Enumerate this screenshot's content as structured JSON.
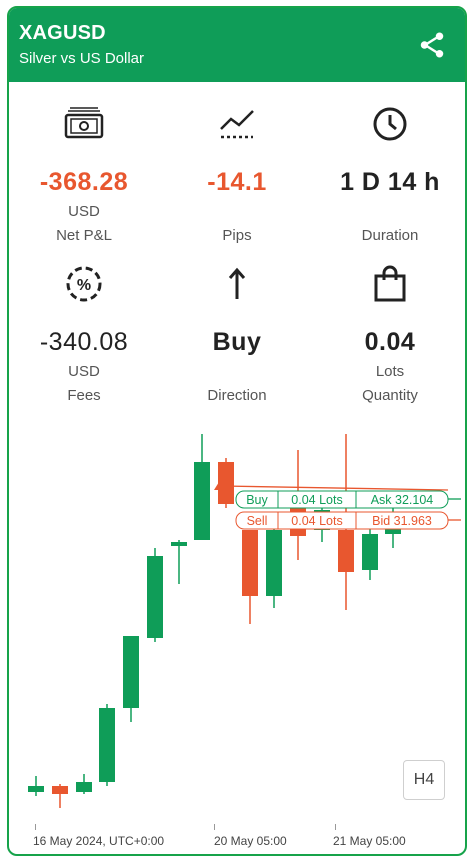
{
  "header": {
    "symbol": "XAGUSD",
    "description": "Silver vs US Dollar",
    "share_icon": "share-icon"
  },
  "stats": [
    {
      "icon": "cash-icon",
      "value": "-368.28",
      "unit": "USD",
      "label": "Net P&L",
      "color": "#e8572f"
    },
    {
      "icon": "trend-line-icon",
      "value": "-14.1",
      "unit": "",
      "label": "Pips",
      "color": "#e8572f"
    },
    {
      "icon": "clock-icon",
      "value": "1 D 14 h",
      "unit": "",
      "label": "Duration"
    },
    {
      "icon": "percent-dashed-icon",
      "value": "-340.08",
      "unit": "USD",
      "label": "Fees"
    },
    {
      "icon": "arrow-up-icon",
      "value": "Buy",
      "unit": "",
      "label": "Direction"
    },
    {
      "icon": "shopping-bag-icon",
      "value": "0.04",
      "unit": "Lots",
      "label": "Quantity"
    }
  ],
  "chart": {
    "timeframe": "H4",
    "time_labels": [
      "16 May 2024, UTC+0:00",
      "20 May 05:00",
      "21 May 05:00"
    ],
    "buy_tag": {
      "side": "Buy",
      "lots": "0.04 Lots",
      "price": "Ask 32.104"
    },
    "sell_tag": {
      "side": "Sell",
      "lots": "0.04 Lots",
      "price": "Bid 31.963"
    },
    "colors": {
      "up": "#0f9d58",
      "down": "#e8572f"
    }
  },
  "chart_data": {
    "type": "candlestick",
    "candles": [
      {
        "dir": "up"
      },
      {
        "dir": "down"
      },
      {
        "dir": "up"
      },
      {
        "dir": "up"
      },
      {
        "dir": "up"
      },
      {
        "dir": "up"
      },
      {
        "dir": "up"
      },
      {
        "dir": "up"
      },
      {
        "dir": "down"
      },
      {
        "dir": "down"
      },
      {
        "dir": "up"
      },
      {
        "dir": "down"
      },
      {
        "dir": "up"
      },
      {
        "dir": "down"
      },
      {
        "dir": "up"
      },
      {
        "dir": "up"
      }
    ],
    "ask": 32.104,
    "bid": 31.963
  }
}
